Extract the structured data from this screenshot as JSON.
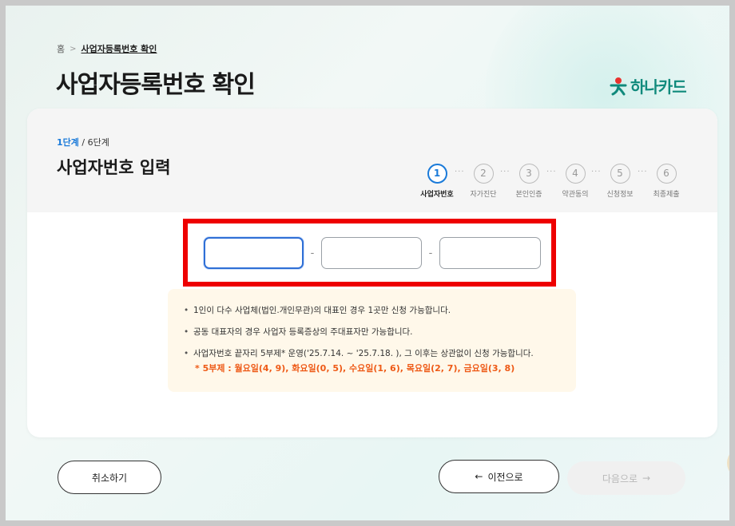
{
  "breadcrumb": {
    "home": "홈",
    "separator": ">",
    "current": "사업자등록번호 확인"
  },
  "page_title": "사업자등록번호 확인",
  "brand": {
    "name": "하나카드",
    "color": "#108a7c",
    "icon": "hana-logo-icon"
  },
  "step_header": {
    "current_step": "1단계",
    "total_steps": "/ 6단계",
    "title": "사업자번호 입력"
  },
  "stepper": {
    "steps": [
      {
        "num": "1",
        "label": "사업자번호",
        "active": true
      },
      {
        "num": "2",
        "label": "자가진단",
        "active": false
      },
      {
        "num": "3",
        "label": "본인인증",
        "active": false
      },
      {
        "num": "4",
        "label": "약관동의",
        "active": false
      },
      {
        "num": "5",
        "label": "신청정보",
        "active": false
      },
      {
        "num": "6",
        "label": "최종제출",
        "active": false
      }
    ],
    "connector": "···",
    "active_color": "#1a7ad9"
  },
  "business_number": {
    "part1": "",
    "part2": "",
    "part3": "",
    "separator": "-"
  },
  "notice": {
    "items": [
      "1인이 다수 사업체(법인.개인무관)의 대표인 경우 1곳만 신청 가능합니다.",
      "공동 대표자의 경우 사업자 등록증상의 주대표자만 가능합니다.",
      "사업자번호 끝자리 5부제* 운영('25.7.14. ~ '25.7.18. ), 그 이후는 상관없이 신청 가능합니다."
    ],
    "rule": "* 5부제 : 월요일(4, 9), 화요일(0, 5), 수요일(1, 6), 목요일(2, 7), 금요일(3, 8)",
    "rule_color": "#ee5a17"
  },
  "buttons": {
    "cancel": "취소하기",
    "prev": "이전으로",
    "prev_icon": "arrow-left-icon",
    "next": "다음으로",
    "next_icon": "arrow-right-icon"
  },
  "highlight_color": "#ee0000"
}
